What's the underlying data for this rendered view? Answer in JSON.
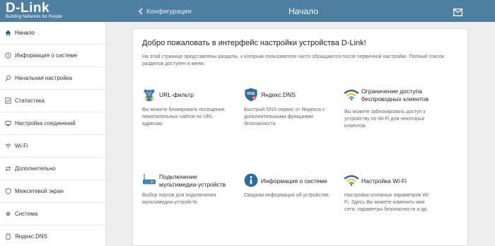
{
  "header": {
    "brand": "D-Link",
    "tagline": "Building Networks for People",
    "back_label": "Конфигурация",
    "page_title": "Начало",
    "mail_icon": "envelope-icon",
    "bar_color": "#4e7fa0"
  },
  "sidebar": {
    "items": [
      {
        "label": "Начало",
        "icon": "home-icon",
        "active": true
      },
      {
        "label": "Информация о системе",
        "icon": "info-icon"
      },
      {
        "label": "Начальная настройка",
        "icon": "magic-wand-icon"
      },
      {
        "label": "Статистика",
        "icon": "stats-icon"
      },
      {
        "label": "Настройка соединений",
        "icon": "connection-icon"
      },
      {
        "label": "Wi-Fi",
        "icon": "wifi-icon"
      },
      {
        "label": "Дополнительно",
        "icon": "arrows-icon"
      },
      {
        "label": "Межсетевой экран",
        "icon": "shield-icon"
      },
      {
        "label": "Система",
        "icon": "gear-icon"
      },
      {
        "label": "Яндекс.DNS",
        "icon": "dns-icon"
      }
    ]
  },
  "main": {
    "title": "Добро пожаловать в интерфейс настройки устройства D-Link!",
    "description": "На этой странице представлены разделы, к которым пользователи часто обращаются после первичной настройки. Полный список разделов доступен в меню.",
    "features": [
      {
        "title": "URL-фильтр",
        "desc": "Вы можете блокировать посещение нежелательных сайтов по URL-адресам.",
        "icon": "teddy-bear-icon"
      },
      {
        "title": "Яндекс.DNS",
        "desc": "Быстрый DNS-сервис от Яндекса с дополнительными функциями безопасности.",
        "icon": "dns-shield-icon"
      },
      {
        "title": "Ограничение доступа беспроводных клиентов",
        "title_line1": "Ограничение доступа",
        "title_line2": "беспроводных клиентов",
        "desc": "Вы можете заблокировать доступ к устройству по Wi-Fi для некоторых клиентов.",
        "icon": "wifi-restrict-icon"
      },
      {
        "title": "Подключение мультимедиа-устройств",
        "title_line1": "Подключение",
        "title_line2": "мультимедиа-устройств",
        "desc": "Выбор портов для подключения мультимедиа-устройств.",
        "icon": "router-icon"
      },
      {
        "title": "Информация о системе",
        "desc": "Сводная информация об устройстве.",
        "icon": "info-circle-icon"
      },
      {
        "title": "Настройка Wi-Fi",
        "desc": "Настройка основных параметров Wi-Fi. Здесь Вы можете изменить имя сети, параметры безопасности и др.",
        "icon": "wifi-settings-icon"
      }
    ]
  }
}
